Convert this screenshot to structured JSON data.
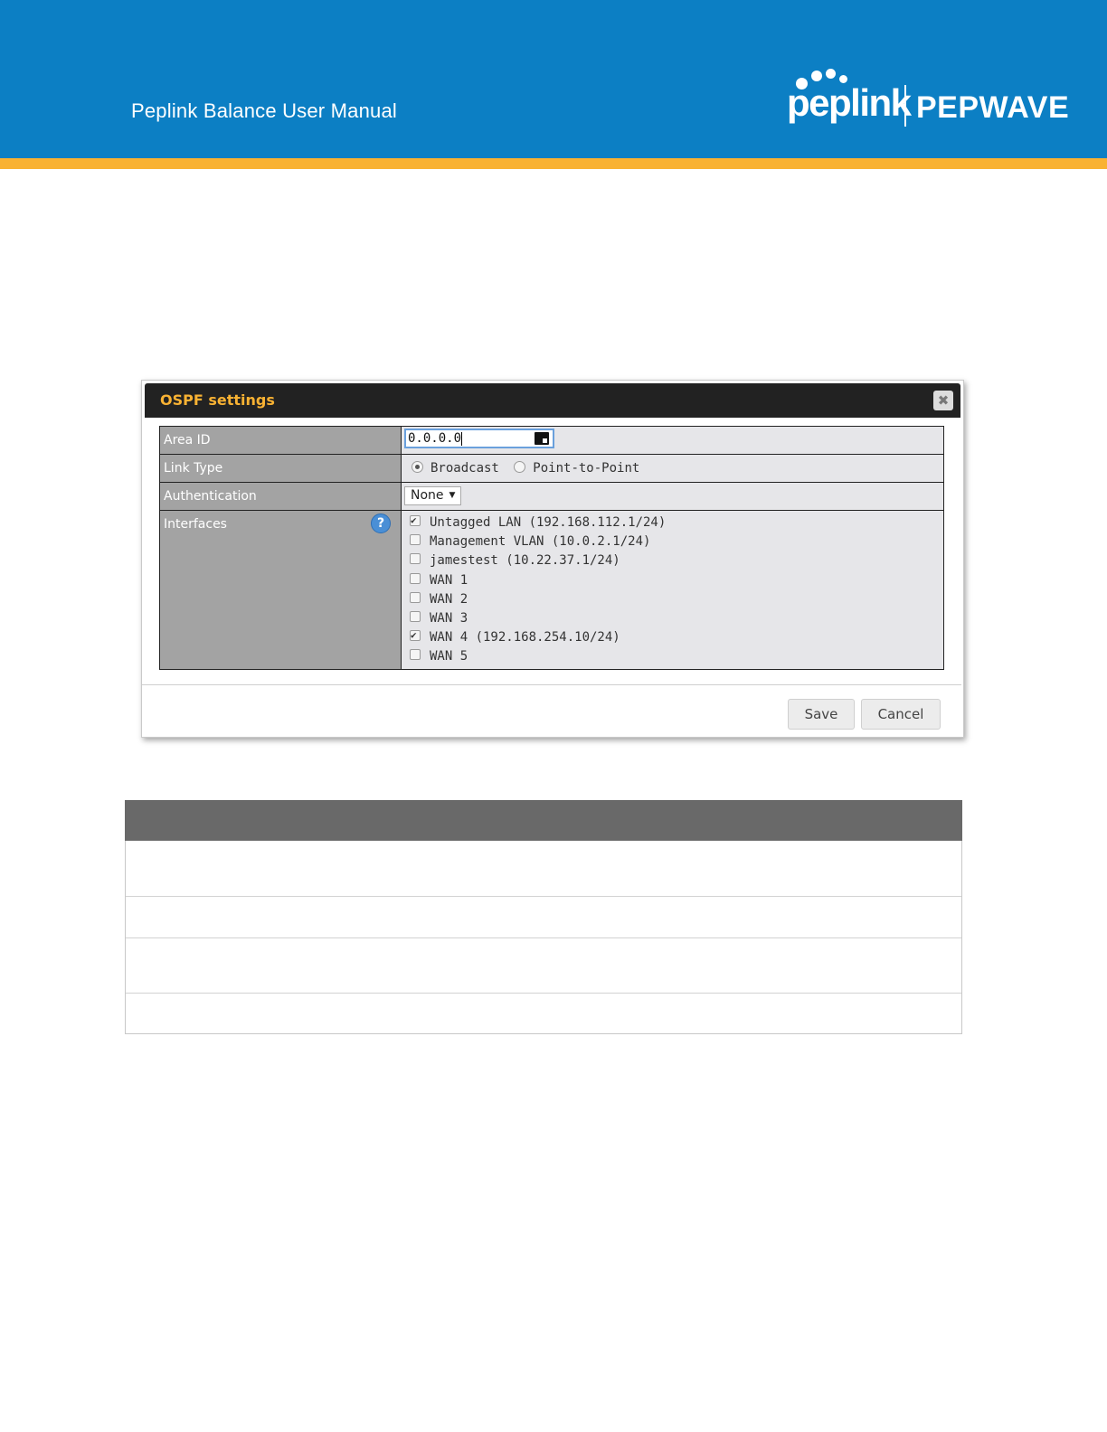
{
  "header": {
    "manual_title": "Peplink Balance User Manual",
    "logo_peplink": "peplink",
    "logo_pepwave": "PEPWAVE",
    "banner_color": "#0c7fc4",
    "stripe_color": "#f9b233"
  },
  "dialog": {
    "title": "OSPF settings",
    "close_icon": "close-icon",
    "fields": {
      "area_id": {
        "label": "Area ID",
        "value": "0.0.0.0"
      },
      "link_type": {
        "label": "Link Type",
        "options": [
          {
            "label": "Broadcast",
            "selected": true
          },
          {
            "label": "Point-to-Point",
            "selected": false
          }
        ]
      },
      "authentication": {
        "label": "Authentication",
        "value": "None"
      },
      "interfaces": {
        "label": "Interfaces",
        "help": "?",
        "items": [
          {
            "label": "Untagged LAN (192.168.112.1/24)",
            "checked": true
          },
          {
            "label": "Management VLAN (10.0.2.1/24)",
            "checked": false
          },
          {
            "label": "jamestest (10.22.37.1/24)",
            "checked": false
          },
          {
            "label": "WAN 1",
            "checked": false
          },
          {
            "label": "WAN 2",
            "checked": false
          },
          {
            "label": "WAN 3",
            "checked": false
          },
          {
            "label": "WAN 4 (192.168.254.10/24)",
            "checked": true
          },
          {
            "label": "WAN 5",
            "checked": false
          }
        ]
      }
    },
    "buttons": {
      "save": "Save",
      "cancel": "Cancel"
    }
  }
}
